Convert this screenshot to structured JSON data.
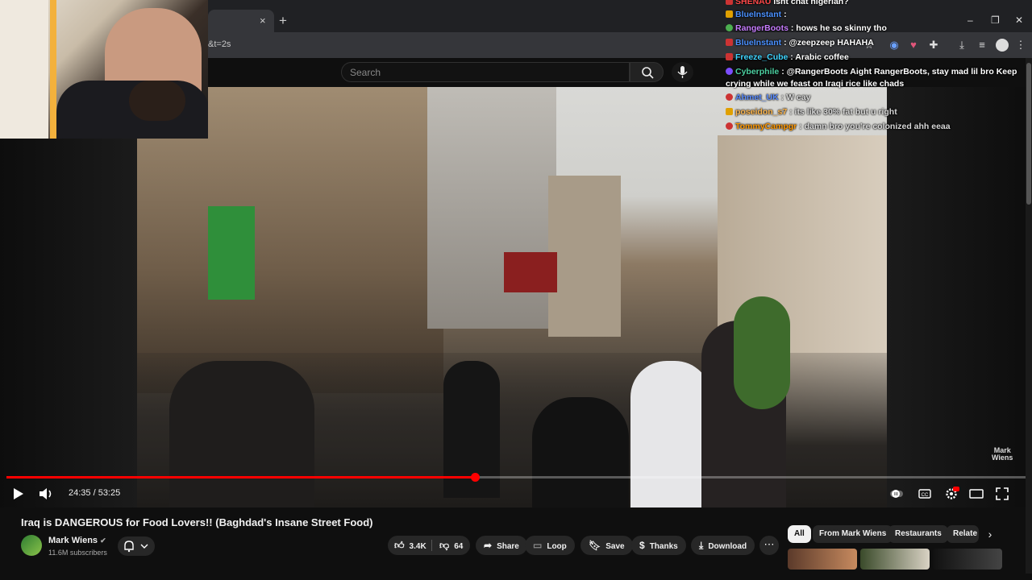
{
  "browser": {
    "url_fragment": "&t=2s",
    "new_tab": "+",
    "close_tab": "×"
  },
  "header": {
    "search_placeholder": "Search"
  },
  "chat": {
    "messages": [
      {
        "user": "SHENAU",
        "user_color": "#ff4a4a",
        "text": "isnt chat nigerian?"
      },
      {
        "user": "BlueInstant",
        "user_color": "#4a90ff",
        "text": ":"
      },
      {
        "user": "RangerBoots",
        "user_color": "#c77dff",
        "text": ": hows he so skinny tho"
      },
      {
        "user": "BlueInstant",
        "user_color": "#4a90ff",
        "text": ": @zeepzeep HAHAHA"
      },
      {
        "user": "Freeze_Cube",
        "user_color": "#3fd4ff",
        "text": ": Arabic coffee"
      },
      {
        "user": "Cyberphile",
        "user_color": "#4dd0a1",
        "text": ": @RangerBoots Aight RangerBoots, stay mad lil bro Keep"
      },
      {
        "user": "",
        "user_color": "#ffffff",
        "text": "crying while we feast on Iraqi rice like chads"
      },
      {
        "user": "Ahmet_UK",
        "user_color": "#5a8cff",
        "text": ": W cay"
      },
      {
        "user": "poseidon_s7",
        "user_color": "#ffb74d",
        "text": ": its like 30% fat  but u right"
      },
      {
        "user": "TommyCampgr",
        "user_color": "#ff9800",
        "text": ": damn bro you're colonized ahh eeaa"
      }
    ]
  },
  "player": {
    "time_current": "24:35",
    "time_total": "53:25",
    "time_display": "24:35 / 53:25",
    "progress_fraction": 0.46,
    "watermark_line1": "Mark",
    "watermark_line2": "Wiens"
  },
  "video": {
    "title": "Iraq is DANGEROUS for Food Lovers!! (Baghdad's Insane Street Food)",
    "channel": "Mark Wiens",
    "subscribers": "11.6M subscribers"
  },
  "actions": {
    "likes": "3.4K",
    "dislikes": "64",
    "share": "Share",
    "loop": "Loop",
    "save": "Save",
    "thanks": "Thanks",
    "download": "Download",
    "more": "⋯"
  },
  "chips": [
    "All",
    "From Mark Wiens",
    "Restaurants",
    "Relate"
  ],
  "colors": {
    "accent": "#ff0000",
    "background": "#0f0f0f",
    "pill": "#272727"
  }
}
